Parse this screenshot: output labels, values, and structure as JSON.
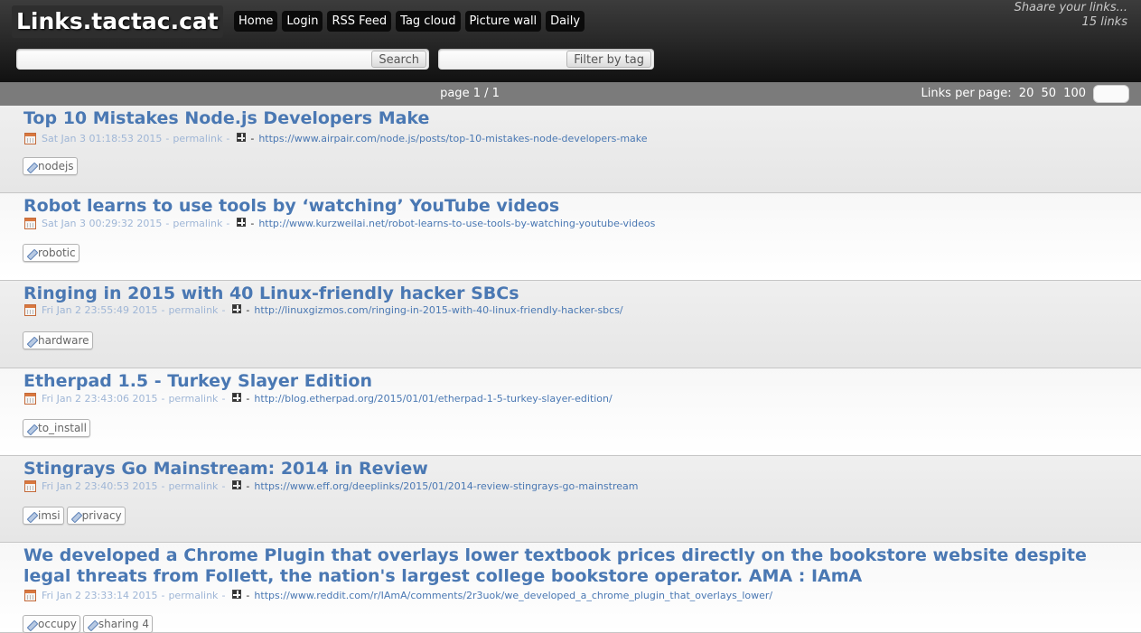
{
  "header": {
    "logo": "Links.tactac.cat",
    "nav": [
      "Home",
      "Login",
      "RSS Feed",
      "Tag cloud",
      "Picture wall",
      "Daily"
    ],
    "tagline": "Shaare your links...",
    "link_count": "15 links"
  },
  "search": {
    "search_button": "Search",
    "search_value": "",
    "tag_button": "Filter by tag",
    "tag_value": ""
  },
  "paging": {
    "page_info": "page 1 / 1",
    "links_per_page_label": "Links per page:",
    "options": [
      "20",
      "50",
      "100"
    ]
  },
  "links": [
    {
      "title": "Top 10 Mistakes Node.js Developers Make",
      "date": "Sat Jan 3 01:18:53 2015",
      "permalink": "permalink",
      "url": "https://www.airpair.com/node.js/posts/top-10-mistakes-node-developers-make",
      "tags": [
        "nodejs"
      ]
    },
    {
      "title": "Robot learns to use tools by ‘watching’ YouTube videos",
      "date": "Sat Jan 3 00:29:32 2015",
      "permalink": "permalink",
      "url": "http://www.kurzweilai.net/robot-learns-to-use-tools-by-watching-youtube-videos",
      "tags": [
        "robotic"
      ]
    },
    {
      "title": "Ringing in 2015 with 40 Linux-friendly hacker SBCs",
      "date": "Fri Jan 2 23:55:49 2015",
      "permalink": "permalink",
      "url": "http://linuxgizmos.com/ringing-in-2015-with-40-linux-friendly-hacker-sbcs/",
      "tags": [
        "hardware"
      ]
    },
    {
      "title": "Etherpad 1.5 - Turkey Slayer Edition",
      "date": "Fri Jan 2 23:43:06 2015",
      "permalink": "permalink",
      "url": "http://blog.etherpad.org/2015/01/01/etherpad-1-5-turkey-slayer-edition/",
      "tags": [
        "to_install"
      ]
    },
    {
      "title": "Stingrays Go Mainstream: 2014 in Review",
      "date": "Fri Jan 2 23:40:53 2015",
      "permalink": "permalink",
      "url": "https://www.eff.org/deeplinks/2015/01/2014-review-stingrays-go-mainstream",
      "tags": [
        "imsi",
        "privacy"
      ]
    },
    {
      "title": "We developed a Chrome Plugin that overlays lower textbook prices directly on the bookstore website despite legal threats from Follett, the nation's largest college bookstore operator. AMA : IAmA",
      "date": "Fri Jan 2 23:33:14 2015",
      "permalink": "permalink",
      "url": "https://www.reddit.com/r/IAmA/comments/2r3uok/we_developed_a_chrome_plugin_that_overlays_lower/",
      "tags": [
        "occupy",
        "sharing 4"
      ]
    }
  ]
}
